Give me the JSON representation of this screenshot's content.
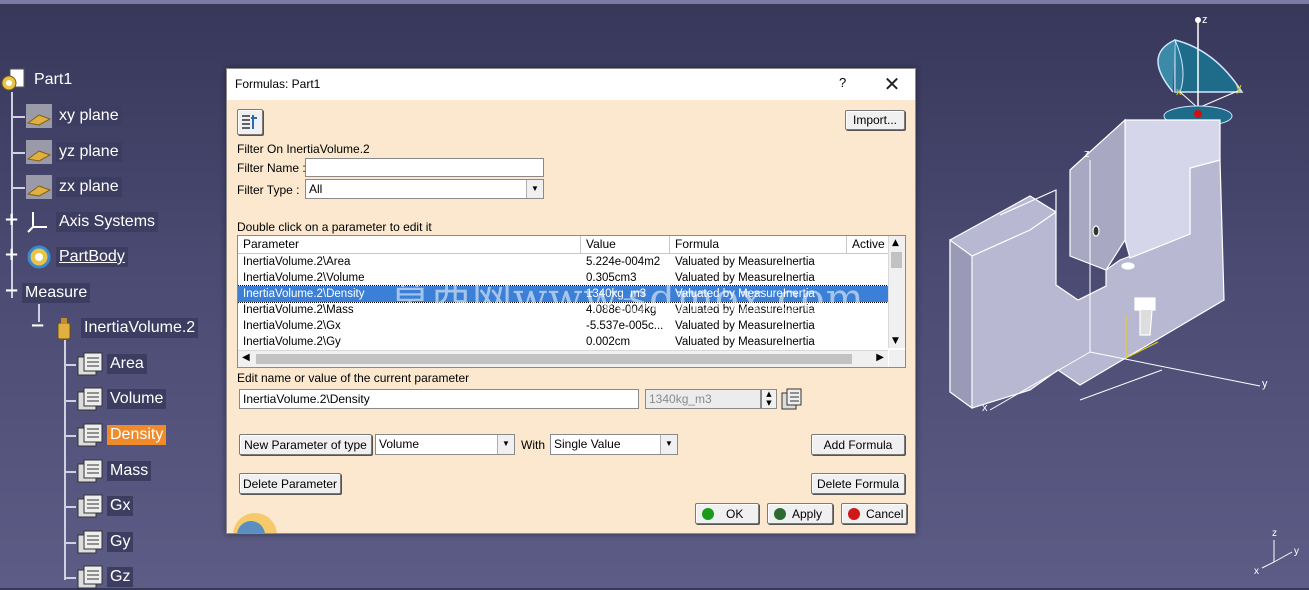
{
  "tree": {
    "items": [
      {
        "label": "Part1"
      },
      {
        "label": "xy plane"
      },
      {
        "label": "yz plane"
      },
      {
        "label": "zx plane"
      },
      {
        "label": "Axis Systems"
      },
      {
        "label": "PartBody"
      },
      {
        "label": "Measure"
      },
      {
        "label": "InertiaVolume.2"
      },
      {
        "label": "Area"
      },
      {
        "label": "Volume"
      },
      {
        "label": "Density"
      },
      {
        "label": "Mass"
      },
      {
        "label": "Gx"
      },
      {
        "label": "Gy"
      },
      {
        "label": "Gz"
      }
    ]
  },
  "dialog": {
    "title": "Formulas: Part1",
    "help": "?",
    "close": "✕",
    "import_label": "Import...",
    "filter_on": "Filter On InertiaVolume.2",
    "filter_name_label": "Filter Name :",
    "filter_name_value": "",
    "filter_type_label": "Filter Type :",
    "filter_type_value": "All",
    "table_caption": "Double click on a parameter to edit it",
    "columns": [
      "Parameter",
      "Value",
      "Formula",
      "Active"
    ],
    "rows": [
      {
        "parameter": "InertiaVolume.2\\Area",
        "value": "5.224e-004m2",
        "formula": "Valuated by MeasureInertia"
      },
      {
        "parameter": "InertiaVolume.2\\Volume",
        "value": "0.305cm3",
        "formula": "Valuated by MeasureInertia"
      },
      {
        "parameter": "InertiaVolume.2\\Density",
        "value": "1340kg_m3",
        "formula": "Valuated by MeasureInertia"
      },
      {
        "parameter": "InertiaVolume.2\\Mass",
        "value": "4.088e-004kg",
        "formula": "Valuated by MeasureInertia"
      },
      {
        "parameter": "InertiaVolume.2\\Gx",
        "value": "-5.537e-005c...",
        "formula": "Valuated by MeasureInertia"
      },
      {
        "parameter": "InertiaVolume.2\\Gy",
        "value": "0.002cm",
        "formula": "Valuated by MeasureInertia"
      }
    ],
    "edit_caption": "Edit name or value of the current parameter",
    "edit_name_value": "InertiaVolume.2\\Density",
    "edit_value": "1340kg_m3",
    "new_param_label": "New Parameter of type",
    "param_type_value": "Volume",
    "with_label": "With",
    "with_value": "Single Value",
    "add_formula_label": "Add Formula",
    "delete_parameter_label": "Delete Parameter",
    "delete_formula_label": "Delete Formula",
    "ok_label": "OK",
    "apply_label": "Apply",
    "cancel_label": "Cancel"
  },
  "watermark": "莫西网www.sdmox.com",
  "viewport": {
    "compass_labels": {
      "z": "z",
      "x": "x",
      "y": "y"
    },
    "part_axis_labels": {
      "z": "z",
      "x": "x",
      "y": "y"
    },
    "corner_axis_labels": {
      "z": "z",
      "x": "x",
      "y": "y"
    }
  },
  "colors": {
    "background": "#4a4a72",
    "selection": "#f18a2a",
    "dialog_bg": "#fbe8cf",
    "row_selected": "#3b7fd6"
  }
}
